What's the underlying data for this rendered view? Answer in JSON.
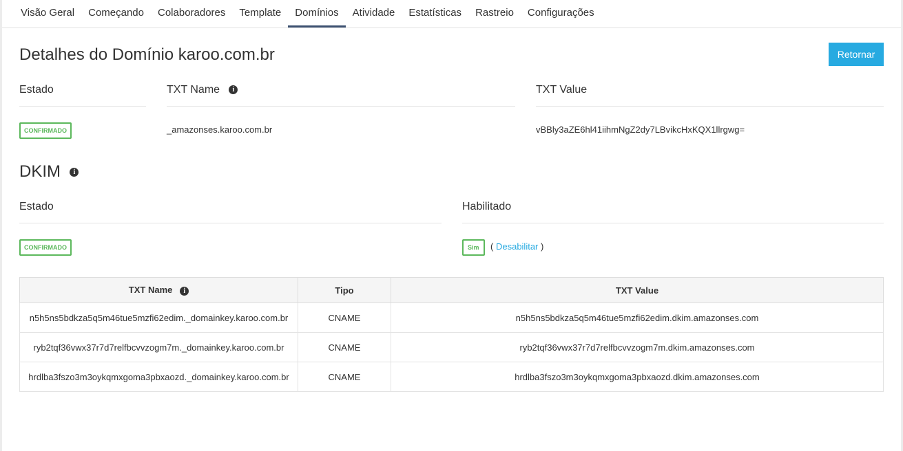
{
  "nav": {
    "tabs": [
      "Visão Geral",
      "Começando",
      "Colaboradores",
      "Template",
      "Domínios",
      "Atividade",
      "Estatísticas",
      "Rastreio",
      "Configurações"
    ],
    "active": 4
  },
  "page_title": "Detalhes do Domínio karoo.com.br",
  "return_button": "Retornar",
  "verification": {
    "estado_label": "Estado",
    "txt_name_label": "TXT Name",
    "txt_value_label": "TXT Value",
    "status": "CONFIRMADO",
    "txt_name": "_amazonses.karoo.com.br",
    "txt_value": "vBBly3aZE6hl41iihmNgZ2dy7LBvikcHxKQX1llrgwg="
  },
  "dkim": {
    "title": "DKIM",
    "estado_label": "Estado",
    "habilitado_label": "Habilitado",
    "status": "CONFIRMADO",
    "enabled": "Sim",
    "open_paren": "(",
    "disable_link": "Desabilitar",
    "close_paren": ")",
    "table": {
      "headers": [
        "TXT Name",
        "Tipo",
        "TXT Value"
      ],
      "rows": [
        [
          "n5h5ns5bdkza5q5m46tue5mzfi62edim._domainkey.karoo.com.br",
          "CNAME",
          "n5h5ns5bdkza5q5m46tue5mzfi62edim.dkim.amazonses.com"
        ],
        [
          "ryb2tqf36vwx37r7d7relfbcvvzogm7m._domainkey.karoo.com.br",
          "CNAME",
          "ryb2tqf36vwx37r7d7relfbcvvzogm7m.dkim.amazonses.com"
        ],
        [
          "hrdlba3fszo3m3oykqmxgoma3pbxaozd._domainkey.karoo.com.br",
          "CNAME",
          "hrdlba3fszo3m3oykqmxgoma3pbxaozd.dkim.amazonses.com"
        ]
      ]
    }
  },
  "info_glyph": "i"
}
